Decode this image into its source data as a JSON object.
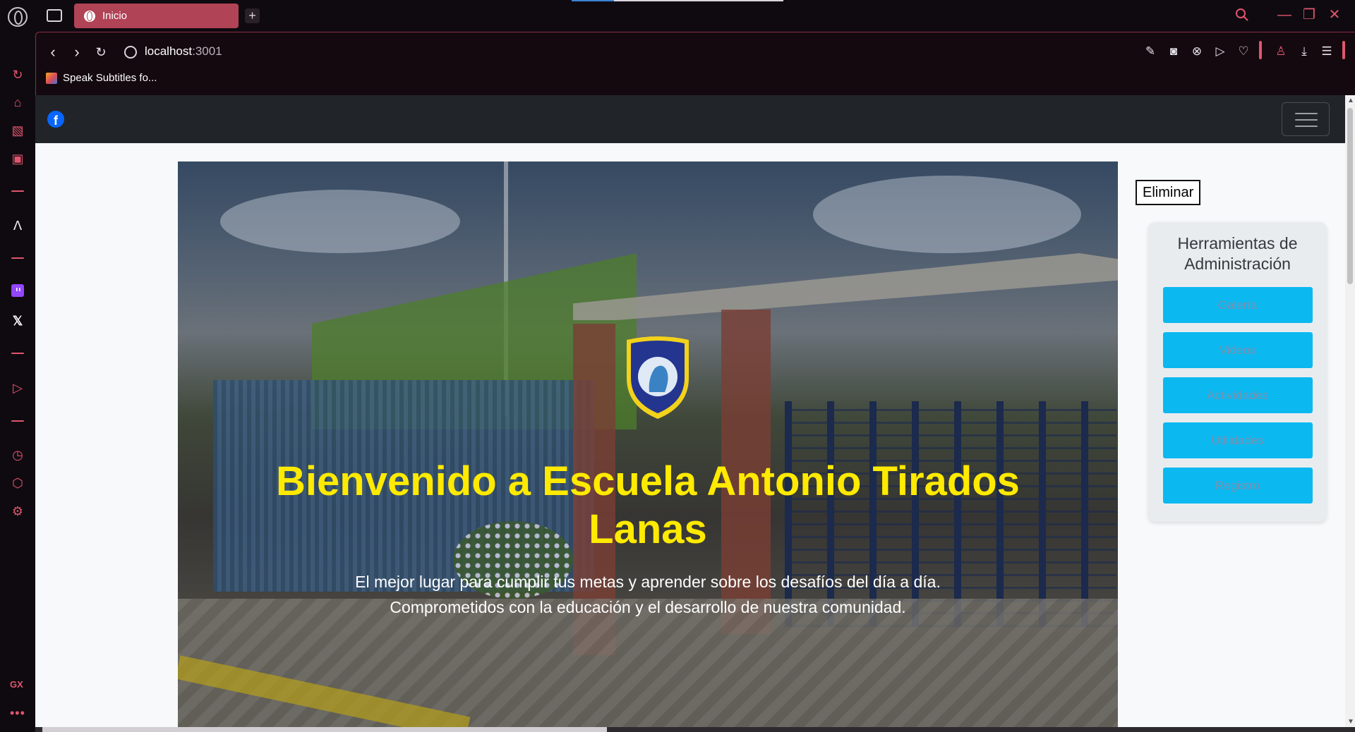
{
  "browser": {
    "tab_title": "Inicio",
    "new_tab_symbol": "+",
    "url_host": "localhost",
    "url_port": ":3001",
    "bookmark_label": "Speak Subtitles fo...",
    "sidebar_label_gx": "GX",
    "sidebar_more": "•••"
  },
  "site": {
    "hero": {
      "title_line1": "Bienvenido a Escuela Antonio Tirados",
      "title_line2": "Lanas",
      "subtitle_line1": "El mejor lugar para cumplir tus metas y aprender sobre los desafíos del día a día.",
      "subtitle_line2": "Comprometidos con la educación y el desarrollo de nuestra comunidad."
    },
    "delete_button": "Eliminar",
    "admin": {
      "title_line1": "Herramientas de",
      "title_line2": "Administración",
      "buttons": [
        "Galería",
        "Videos",
        "Actividades",
        "Utilidades",
        "Registro"
      ]
    }
  },
  "colors": {
    "title_yellow": "#ffea00",
    "admin_button": "#0cb8f0",
    "accent": "#e0566e",
    "navbar": "#212529"
  },
  "icons": [
    "opera-gx-logo-icon",
    "tab-switcher-icon",
    "globe-icon",
    "facebook-icon",
    "hamburger-menu-icon",
    "search-icon",
    "reload-icon"
  ]
}
